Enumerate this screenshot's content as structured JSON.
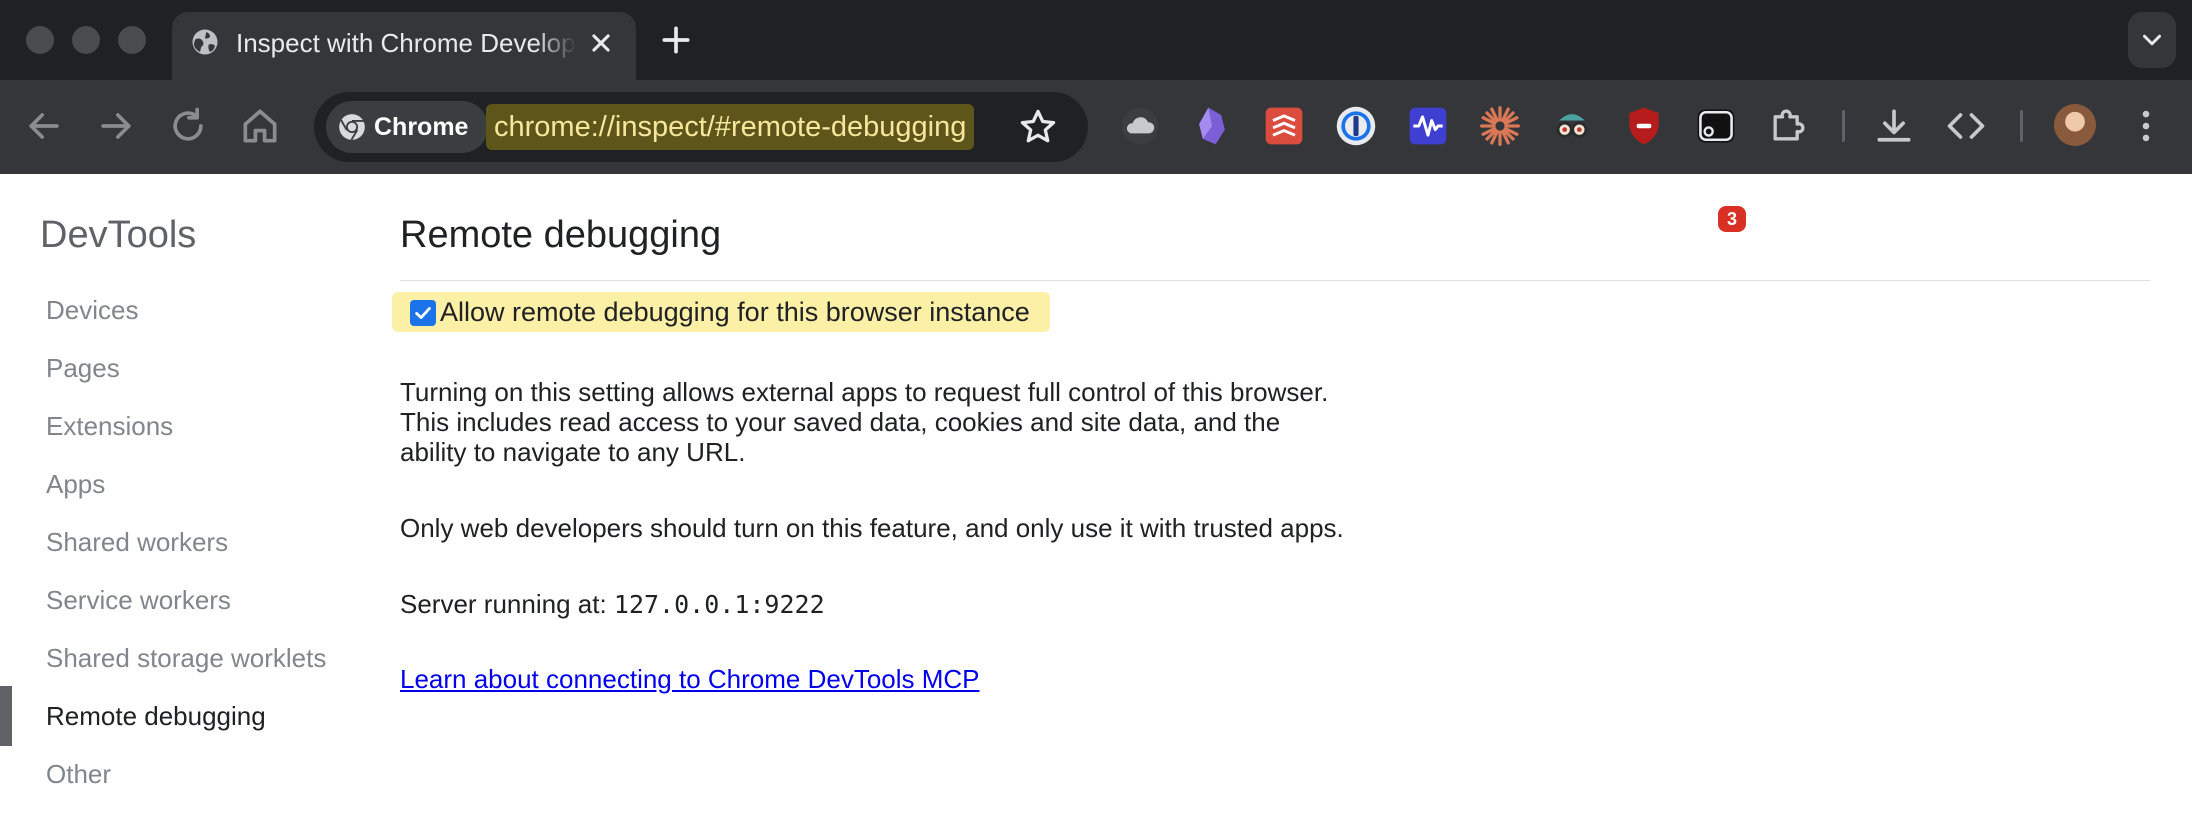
{
  "browser": {
    "tab": {
      "title": "Inspect with Chrome Developer Tools",
      "favicon": "globe-icon",
      "close_icon": "close-icon"
    },
    "new_tab_icon": "plus-icon",
    "tab_search_icon": "chevron-down-icon",
    "nav": {
      "back_icon": "arrow-left-icon",
      "forward_icon": "arrow-right-icon",
      "reload_icon": "reload-icon",
      "home_icon": "home-icon"
    },
    "omnibox": {
      "chip_label": "Chrome",
      "url": "chrome://inspect/#remote-debugging",
      "bookmark_icon": "star-icon"
    },
    "extensions": [
      {
        "name": "cloud-extension-icon"
      },
      {
        "name": "obsidian-extension-icon"
      },
      {
        "name": "todoist-extension-icon"
      },
      {
        "name": "onepassword-extension-icon"
      },
      {
        "name": "waveform-extension-icon"
      },
      {
        "name": "sunburst-extension-icon"
      },
      {
        "name": "spy-glasses-extension-icon"
      },
      {
        "name": "shield-extension-icon"
      },
      {
        "name": "screen-capture-extension-icon",
        "badge": "3"
      },
      {
        "name": "puzzle-extensions-icon"
      }
    ],
    "download_icon": "download-icon",
    "devtools_icon": "code-icon",
    "menu_icon": "kebab-menu-icon",
    "accent": "#1a73e8",
    "url_highlight": "#5e551b"
  },
  "sidebar": {
    "title": "DevTools",
    "items": [
      {
        "label": "Devices"
      },
      {
        "label": "Pages"
      },
      {
        "label": "Extensions"
      },
      {
        "label": "Apps"
      },
      {
        "label": "Shared workers"
      },
      {
        "label": "Service workers"
      },
      {
        "label": "Shared storage worklets"
      },
      {
        "label": "Remote debugging",
        "selected": true
      },
      {
        "label": "Other"
      }
    ]
  },
  "main": {
    "title": "Remote debugging",
    "allow_checkbox": {
      "label": "Allow remote debugging for this browser instance",
      "checked": true
    },
    "description": [
      "Turning on this setting allows external apps to request full control of this browser.",
      "This includes read access to your saved data, cookies and site data, and the",
      "ability to navigate to any URL."
    ],
    "warning": "Only web developers should turn on this feature, and only use it with trusted apps.",
    "server_label": "Server running at:",
    "server_value": "127.0.0.1:9222",
    "learn_link": "Learn about connecting to Chrome DevTools MCP"
  }
}
